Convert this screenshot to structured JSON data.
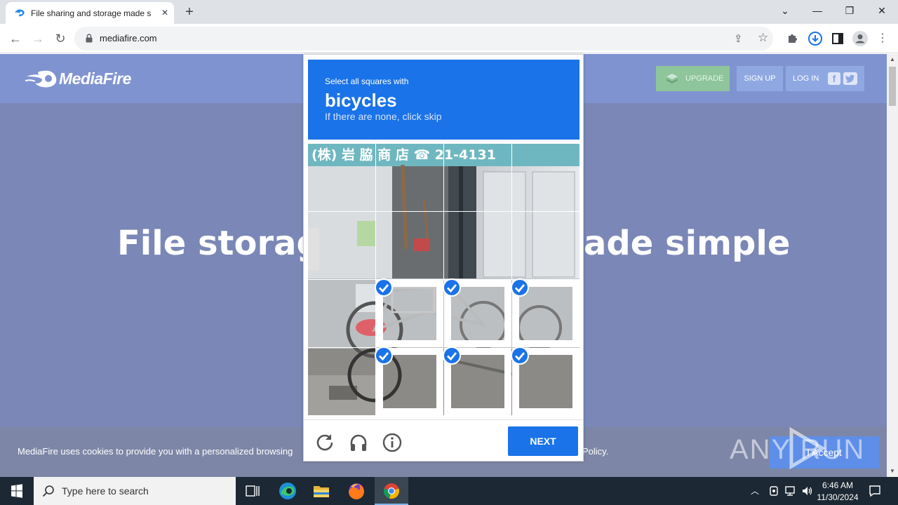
{
  "browser": {
    "tab_title": "File sharing and storage made si",
    "url": "mediafire.com"
  },
  "page": {
    "logo_text": "MediaFire",
    "upgrade_label": "UPGRADE",
    "signup_label": "SIGN UP",
    "login_label": "LOG IN",
    "hero_left": "File storag",
    "hero_right": "ade simple",
    "cookie_text": "MediaFire uses cookies to provide you with a personalized browsing",
    "cookie_tail": "Policy.",
    "accept_label": "I Accept",
    "watermark_text": "ANY RUN"
  },
  "captcha": {
    "instruction": "Select all squares with",
    "target": "bicycles",
    "hint": "If there are none, click skip",
    "next_label": "NEXT",
    "sign_text": "(株) 岩 脇 商 店  ☎ 21-4131",
    "tiles_selected": [
      false,
      false,
      false,
      false,
      false,
      false,
      false,
      false,
      false,
      true,
      true,
      true,
      false,
      true,
      true,
      true
    ]
  },
  "taskbar": {
    "search_placeholder": "Type here to search",
    "time": "6:46 AM",
    "date": "11/30/2024"
  },
  "colors": {
    "captcha_blue": "#1a73e8",
    "page_bg": "#7b87b6",
    "header_bg": "#7f93d1"
  }
}
